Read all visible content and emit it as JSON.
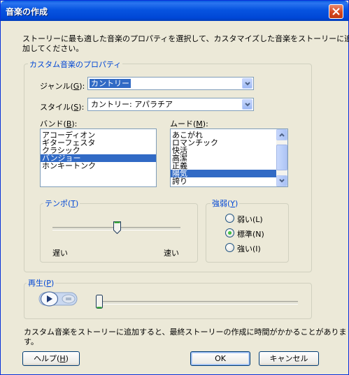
{
  "window": {
    "title": "音楽の作成"
  },
  "intro_text": "ストーリーに最も適した音楽のプロパティを選択して、カスタマイズした音楽をストーリーに追加してください。",
  "intro_line1": "ストーリーに最も適した音楽のプロパティを選択して、カスタマイズした音楽をストーリーに追",
  "intro_line2": "加してください。",
  "properties": {
    "group_label": "カスタム音楽のプロパティ",
    "genre": {
      "label": "ジャンル(G):",
      "value": "カントリー"
    },
    "style": {
      "label": "スタイル(S):",
      "value": "カントリー: アパラチア"
    },
    "band": {
      "label": "バンド(B):",
      "items": [
        "アコーディオン",
        "ギターフェスタ",
        "クラシック",
        "バンジョー",
        "ホンキートンク"
      ],
      "selected": "バンジョー"
    },
    "mood": {
      "label": "ムード(M):",
      "items": [
        "あこがれ",
        "ロマンチック",
        "快活",
        "高潔",
        "正義",
        "陽気",
        "誇り"
      ],
      "selected": "陽気"
    },
    "tempo": {
      "label": "テンポ(T)",
      "slow": "遅い",
      "fast": "速い",
      "level": 0.5
    },
    "intensity": {
      "label": "強弱(Y)",
      "options": [
        "弱い(L)",
        "標準(N)",
        "強い(I)"
      ],
      "selected": "標準(N)"
    }
  },
  "playback": {
    "label": "再生(P)",
    "position": 0.0
  },
  "notice_line1": "カスタム音楽をストーリーに追加すると、最終ストーリーの作成に時間がかかることがありま",
  "notice_line2": "す。",
  "buttons": {
    "help": "ヘルプ(H)",
    "ok": "OK",
    "cancel": "キャンセル"
  }
}
